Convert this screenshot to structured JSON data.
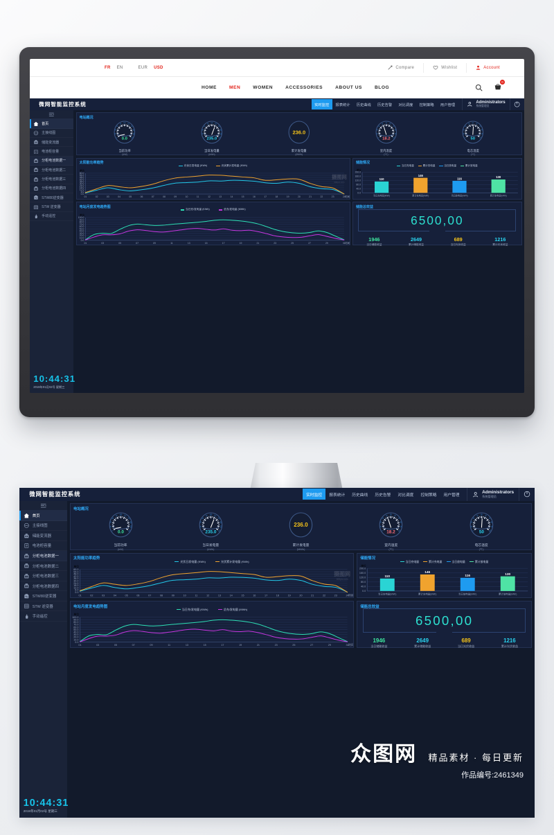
{
  "ecommerce": {
    "locales": [
      {
        "label": "FR",
        "active": true
      },
      {
        "label": "EN",
        "active": false
      }
    ],
    "currencies": [
      {
        "label": "EUR",
        "active": false
      },
      {
        "label": "USD",
        "active": true
      }
    ],
    "actions": [
      {
        "label": "Compare",
        "icon": "compare-icon"
      },
      {
        "label": "Wishlist",
        "icon": "heart-icon"
      },
      {
        "label": "Account",
        "icon": "user-icon",
        "accent": true
      }
    ],
    "menu": [
      {
        "label": "HOME",
        "active": false
      },
      {
        "label": "MEN",
        "active": true
      },
      {
        "label": "WOMEN",
        "active": false
      },
      {
        "label": "ACCESSORIES",
        "active": false
      },
      {
        "label": "ABOUT US",
        "active": false
      },
      {
        "label": "BLOG",
        "active": false
      }
    ],
    "search_icon": "search-icon",
    "cart_icon": "cart-icon",
    "cart_count": "0"
  },
  "header": {
    "title": "微网智能监控系统",
    "nav": [
      {
        "label": "实时监控",
        "active": true
      },
      {
        "label": "报表统计",
        "active": false
      },
      {
        "label": "历史曲线",
        "active": false
      },
      {
        "label": "历史告警",
        "active": false
      },
      {
        "label": "对比调度",
        "active": false
      },
      {
        "label": "控制策略",
        "active": false
      },
      {
        "label": "用户管理",
        "active": false
      }
    ],
    "user_name": "Administrators",
    "user_role": "系统管理员",
    "power_icon": "power-icon",
    "accent": "#1e9bf0"
  },
  "sidebar": {
    "toggle_icon": "menu-collapse-icon",
    "items": [
      {
        "label": "首页",
        "icon": "home-icon",
        "state": "active"
      },
      {
        "label": "主接线图",
        "icon": "circuit-icon",
        "state": ""
      },
      {
        "label": "储能变流器",
        "icon": "converter-icon",
        "state": ""
      },
      {
        "label": "电池柜容量",
        "icon": "clipboard-icon",
        "state": ""
      },
      {
        "label": "分柜电池数据一",
        "icon": "battery-cabinet-icon",
        "state": "sel"
      },
      {
        "label": "分柜电池数据二",
        "icon": "battery-cabinet-icon",
        "state": ""
      },
      {
        "label": "分柜电池数据三",
        "icon": "battery-cabinet-icon",
        "state": ""
      },
      {
        "label": "分柜电池数据四",
        "icon": "battery-cabinet-icon",
        "state": ""
      },
      {
        "label": "STW80逆变器",
        "icon": "inverter-icon",
        "state": ""
      },
      {
        "label": "STW 逆变器",
        "icon": "inverter-grid-icon",
        "state": ""
      },
      {
        "label": "手动遥控",
        "icon": "hand-icon",
        "state": ""
      }
    ],
    "clock_time": "10:44:31",
    "clock_date": "2019年01月02号  星期三"
  },
  "overview": {
    "title": "电站概况",
    "gauges": [
      {
        "value": "0.0",
        "label": "当前功率",
        "unit": "(kW)",
        "color": "#3ee8a0",
        "pct": 0.0,
        "kind": "dial",
        "ticks": [
          "0",
          "20",
          "40",
          "60",
          "80",
          "100",
          "120",
          "140",
          "160",
          "180",
          "200"
        ]
      },
      {
        "value": "235.0",
        "label": "当日发电量",
        "unit": "(kWh)",
        "color": "#2ad4f0",
        "pct": 0.62,
        "kind": "dial",
        "ticks": [
          "0",
          "20",
          "40",
          "60",
          "80",
          "100",
          "120",
          "140",
          "160",
          "180",
          "200"
        ]
      },
      {
        "value": "236.0",
        "label": "累计发电量",
        "unit": "(MWh)",
        "color": "#f5c319",
        "pct": 0,
        "kind": "plain",
        "ticks": []
      },
      {
        "value": "18.2",
        "label": "室内温度",
        "unit": "(℃)",
        "color": "#ff6f7a",
        "pct": 0.4,
        "kind": "dial",
        "ticks": [
          "0",
          "10",
          "20",
          "30",
          "40",
          "50",
          "60",
          "70",
          "80",
          "90",
          "100"
        ]
      },
      {
        "value": "50",
        "label": "电芯温度",
        "unit": "(℃)",
        "color": "#2ad4f0",
        "pct": 0.52,
        "kind": "dial",
        "ticks": [
          "0",
          "10",
          "20",
          "30",
          "40",
          "50",
          "60",
          "70",
          "80",
          "90",
          "100"
        ]
      }
    ]
  },
  "chart_data": [
    {
      "id": "solar_power_trend",
      "type": "line",
      "title": "太阳能功率趋势",
      "unit_label": "单位",
      "xlabel": "时间",
      "ylabel": "",
      "ylim": [
        0,
        60
      ],
      "yticks": [
        "0.0",
        "6.0",
        "12.0",
        "18.0",
        "24.0",
        "30.0",
        "36.0",
        "42.0",
        "48.0",
        "54.0",
        "60.0"
      ],
      "x": [
        "01",
        "02",
        "03",
        "04",
        "05",
        "06",
        "07",
        "08",
        "09",
        "10",
        "11",
        "12",
        "13",
        "14",
        "15",
        "16",
        "17",
        "18",
        "19",
        "20",
        "21",
        "22",
        "23",
        "24"
      ],
      "grid": true,
      "legend_position": "top-center",
      "series": [
        {
          "name": "光伏日发电量 (KWh)",
          "color": "#22c7e8",
          "values": [
            3.0,
            11.0,
            18.0,
            12.5,
            9.0,
            12.5,
            17.5,
            25.0,
            31.5,
            33.0,
            34.5,
            38.0,
            37.5,
            39.5,
            39.0,
            37.0,
            32.5,
            31.0,
            34.5,
            31.0,
            21.0,
            15.5,
            13.0,
            0.5
          ]
        },
        {
          "name": "光伏累计发电量 (KWh)",
          "color": "#f0a32e",
          "values": [
            4.0,
            15.0,
            24.5,
            21.0,
            18.0,
            22.0,
            28.5,
            38.5,
            46.0,
            49.0,
            51.5,
            54.5,
            54.0,
            51.5,
            49.0,
            46.5,
            39.5,
            41.0,
            43.5,
            42.5,
            30.5,
            21.5,
            17.5,
            0.2
          ]
        }
      ]
    },
    {
      "id": "storage_status",
      "type": "bar",
      "title": "储能情况",
      "unit_label": "单位",
      "ylim": [
        0,
        200
      ],
      "yticks": [
        "0.0",
        "40.0",
        "80.0",
        "120.0",
        "160.0",
        "200.0"
      ],
      "grid": true,
      "legend_position": "top-center",
      "categories": [
        "当日充电量(kWh)",
        "累计充电量(kWh)",
        "当日放电量(kWh)",
        "累计放电量(kWh)"
      ],
      "values": [
        110,
        146,
        116,
        130
      ],
      "bar_colors": [
        "#2ad4d4",
        "#f0a32e",
        "#1e9bf0",
        "#4fe3a5"
      ],
      "legend": [
        "当日充电量",
        "累计充电量",
        "当日放电量",
        "累计放电量"
      ]
    },
    {
      "id": "monthly_generation_trend",
      "type": "line",
      "title": "电站月度发电趋势图",
      "unit_label": "单位",
      "xlabel": "时间",
      "ylim": [
        0,
        100
      ],
      "yticks": [
        "0.0",
        "10.0",
        "20.0",
        "30.0",
        "40.0",
        "50.0",
        "60.0",
        "70.0",
        "80.0",
        "90.0",
        "100.0"
      ],
      "x": [
        "01",
        "02",
        "03",
        "04",
        "05",
        "06",
        "07",
        "08",
        "09",
        "10",
        "11",
        "12",
        "13",
        "14",
        "15",
        "16",
        "17",
        "18",
        "19",
        "20",
        "21",
        "22",
        "23",
        "24",
        "25",
        "26",
        "27",
        "28",
        "29",
        "30",
        "31"
      ],
      "grid": true,
      "legend_position": "top-center",
      "series": [
        {
          "name": "当日充/发电量 (KWh)",
          "color": "#2de0b5",
          "values": [
            2,
            25,
            31,
            30,
            48,
            64,
            71,
            68,
            65,
            66,
            70,
            73,
            76,
            79,
            83,
            88,
            90,
            88,
            85,
            80,
            72,
            60,
            47,
            38,
            33,
            31,
            34,
            41,
            34,
            18,
            2
          ]
        },
        {
          "name": "总充/发电量 (MWh)",
          "color": "#c636e0",
          "values": [
            1,
            14,
            24,
            24,
            28,
            40,
            46,
            43,
            38,
            36,
            40,
            45,
            50,
            52,
            48,
            45,
            50,
            44,
            42,
            44,
            38,
            29,
            19,
            14,
            12,
            13,
            19,
            25,
            17,
            8,
            1
          ]
        }
      ]
    }
  ],
  "benefit": {
    "title": "储能总效益",
    "big_value": "6500,00",
    "items": [
      {
        "value": "1946",
        "caption": "当日储能收益",
        "color": "#3ee8a0"
      },
      {
        "value": "2649",
        "caption": "累计储能收益",
        "color": "#2ad4f0"
      },
      {
        "value": "689",
        "caption": "当日光伏收益",
        "color": "#f5c319"
      },
      {
        "value": "1216",
        "caption": "累计光伏收益",
        "color": "#2ad4f0"
      }
    ]
  },
  "watermarks": {
    "chart_mark": "摄图网",
    "chart_mark_sub": "699pic.com",
    "brand": "众图网",
    "brand_tag": "精品素材 · 每日更新",
    "product_id": "作品编号:2461349"
  }
}
